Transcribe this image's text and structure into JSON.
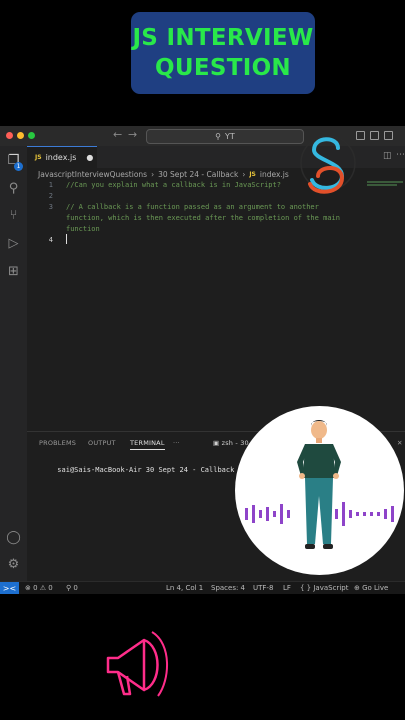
{
  "banner": {
    "line1": "JS INTERVIEW",
    "line2": "QUESTION"
  },
  "titlebar": {
    "search_text": "YT"
  },
  "colors": {
    "accent": "#1d6fcf",
    "banner_bg": "#1f3f82",
    "banner_text": "#29e84a",
    "comment": "#6a9955",
    "neon": "#ff2d8a"
  },
  "tab": {
    "file_label": "JS",
    "filename": "index.js"
  },
  "breadcrumb": {
    "folder1": "JavascriptInterviewQuestions",
    "folder2": "30 Sept 24 - Callback",
    "file_icon": "JS",
    "file": "index.js"
  },
  "editor": {
    "line_numbers": [
      "1",
      "2",
      "3",
      "4"
    ],
    "lines": [
      "//Can you explain what a callback is in JavaScript?",
      "",
      "// A callback is a function passed as an argument to another\nfunction, which is then executed after the completion of the main\nfunction"
    ]
  },
  "activity_badge": "1",
  "panel": {
    "tabs": [
      "PROBLEMS",
      "OUTPUT",
      "TERMINAL",
      "···"
    ],
    "shell": "zsh - 30",
    "prompt": "sai@Sais-MacBook-Air 30 Sept 24 - Callback %"
  },
  "status": {
    "remote_icon": "><",
    "problems": "⊗ 0 ⚠ 0",
    "ports": "⚲ 0",
    "position": "Ln 4, Col 1",
    "spaces": "Spaces: 4",
    "encoding": "UTF-8",
    "eol": "LF",
    "language": "{ } JavaScript",
    "golive": "⊕ Go Live"
  }
}
